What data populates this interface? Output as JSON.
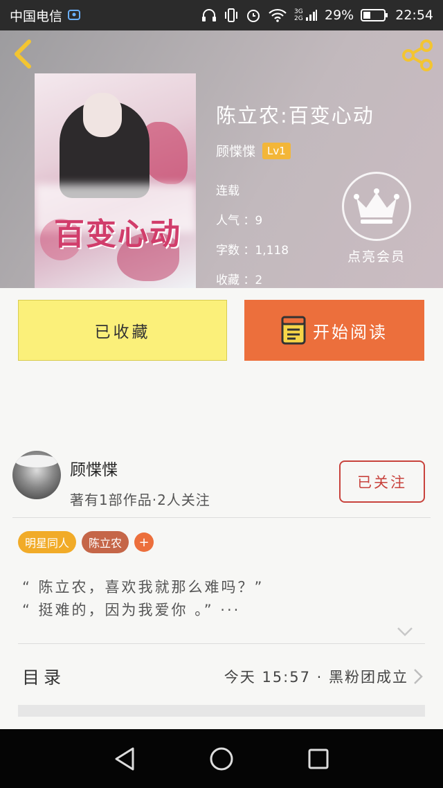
{
  "status_bar": {
    "carrier": "中国电信",
    "network": "3G 2G",
    "battery": "29%",
    "time": "22:54"
  },
  "header": {
    "cover_title": "百变心动",
    "book_title": "陈立农:百变心动",
    "author": "顾惵惵",
    "level": "Lv1",
    "status": "连载",
    "popularity": "人气 ：9",
    "word_count": "字数 ：1,118",
    "favorites": "收藏 ：2",
    "member_label": "点亮会员"
  },
  "actions": {
    "collected_label": "已收藏",
    "read_label": "开始阅读"
  },
  "author_card": {
    "name": "顾惵惵",
    "stats": "著有1部作品·2人关注",
    "follow_label": "已关注"
  },
  "tags": [
    "明星同人",
    "陈立农",
    "+"
  ],
  "synopsis": {
    "line1": "“ 陈立农，喜欢我就那么难吗？”",
    "line2": "“ 挺难的，因为我爱你 。” ···"
  },
  "toc": {
    "label": "目录",
    "latest": "今天 15:57 · 黑粉团成立"
  },
  "colors": {
    "accent_orange": "#ec6f3c",
    "collected_yellow": "#fbf07a",
    "tag_yellow": "#f1ab28",
    "tag_brown": "#c56648",
    "follow_red": "#c8423c",
    "icon_yellow": "#f3c531"
  },
  "icons": [
    "back-arrow-icon",
    "share-icon",
    "crown-icon",
    "book-icon",
    "chevron-down-icon",
    "chevron-right-icon",
    "nav-back-icon",
    "nav-home-icon",
    "nav-recents-icon"
  ]
}
